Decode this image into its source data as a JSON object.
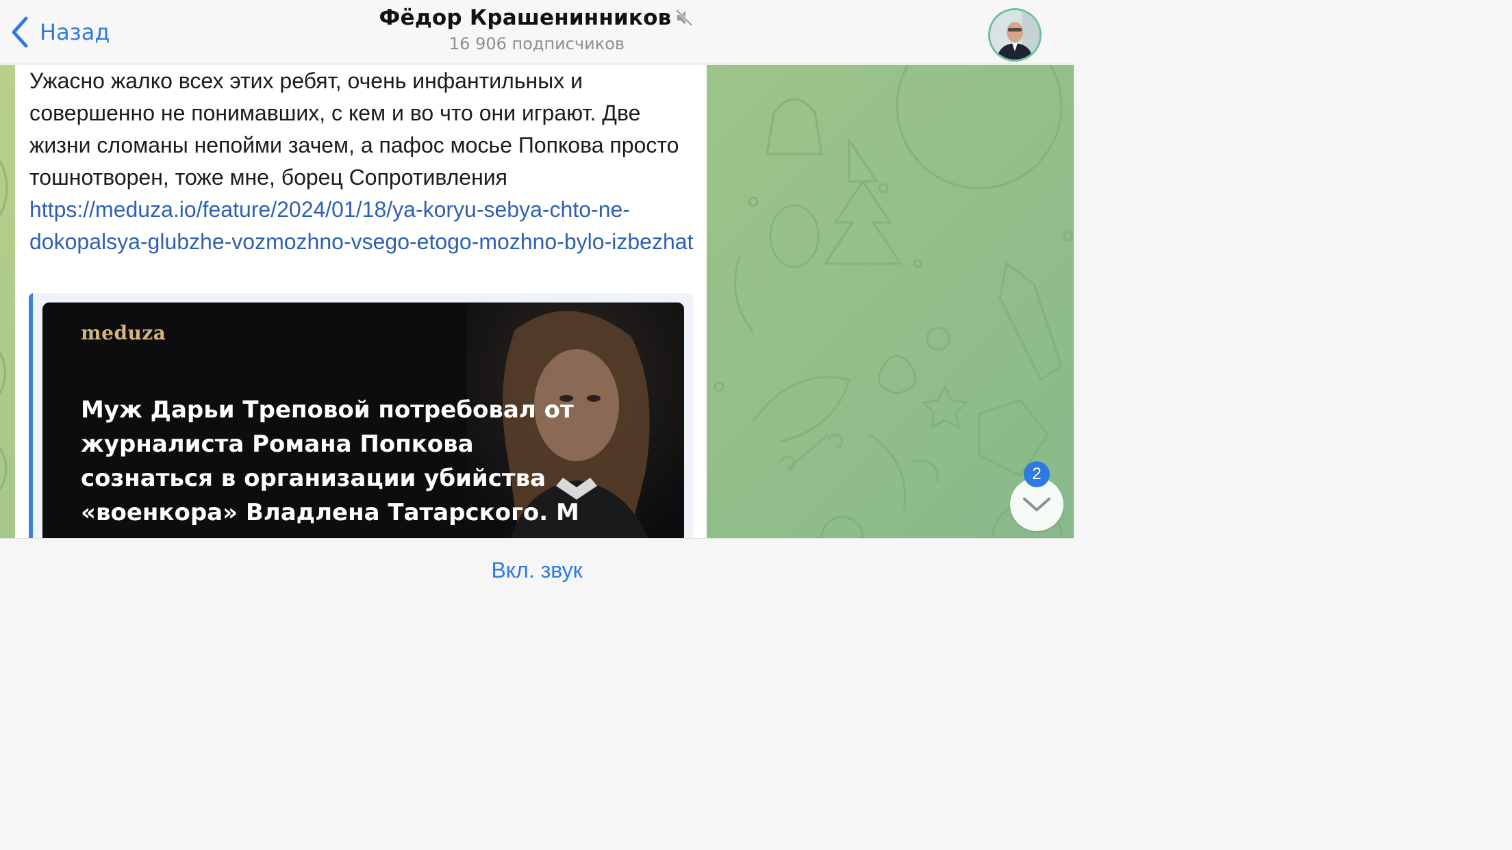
{
  "header": {
    "back_label": "Назад",
    "channel_title": "Фёдор Крашенинников",
    "subscribers": "16 906 подписчиков",
    "muted": true
  },
  "message": {
    "text": "Ужасно жалко всех этих ребят, очень инфантильных и совершенно не понимавших, с кем и во что они играют. Две жизни сломаны непойми зачем, а пафос мосье Попкова просто тошнотворен, тоже мне, борец Сопротивления ",
    "link_text": "https://meduza.io/feature/2024/01/18/ya-koryu-sebya-chto-ne-dokopalsya-glubzhe-vozmozhno-vsego-etogo-mozhno-bylo-izbezhat",
    "link_color": "#2f5fb3"
  },
  "link_preview": {
    "brand": "meduza",
    "headline": "Муж Дарьи Треповой потребовал от журналиста Романа Попкова сознаться в организации убийства «военкора» Владлена Татарского. М",
    "accent_bar_color": "#3d7ee0"
  },
  "scroll_button": {
    "badge_count": "2",
    "icon": "chevron-down-icon"
  },
  "bottom_bar": {
    "unmute_label": "Вкл. звук"
  },
  "colors": {
    "accent": "#2f7ae0",
    "chat_background": "#9ec489"
  }
}
